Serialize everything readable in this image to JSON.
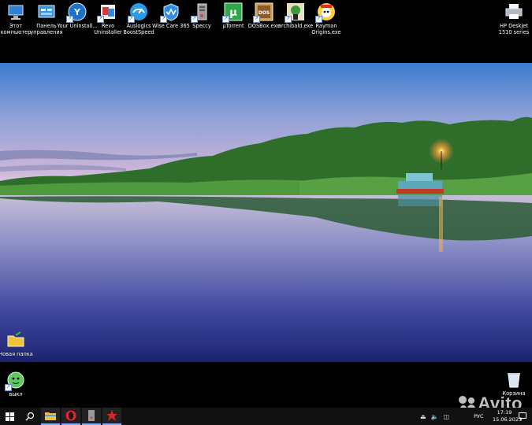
{
  "desktop": {
    "top_icons": [
      {
        "name": "this-pc-icon",
        "label": "Этот компьютер"
      },
      {
        "name": "control-panel-icon",
        "label": "Панель управления"
      },
      {
        "name": "your-uninstaller-icon",
        "label": "Your Uninstall..."
      },
      {
        "name": "revo-uninstaller-icon",
        "label": "Revo Uninstaller"
      },
      {
        "name": "auslogics-icon",
        "label": "Auslogics BoostSpeed"
      },
      {
        "name": "wise-care-icon",
        "label": "Wise Care 365"
      },
      {
        "name": "speccy-icon",
        "label": "Speccy"
      },
      {
        "name": "utorrent-icon",
        "label": "µTorrent"
      },
      {
        "name": "dosbox-icon",
        "label": "DOSBox.exe"
      },
      {
        "name": "archibald-icon",
        "label": "archibald.exe"
      },
      {
        "name": "rayman-icon",
        "label": "Rayman Origins.exe"
      }
    ],
    "printer_icon": {
      "label": "HP Deskjet 1510 series"
    },
    "folder_icon": {
      "label": "Новая папка"
    },
    "shutdown_icon": {
      "label": "выкл"
    },
    "recycle_bin": {
      "label": "Корзина"
    }
  },
  "taskbar": {
    "lang": "РУС",
    "time": "17:19",
    "date": "15.06.2023"
  },
  "watermark": {
    "text": "Avito"
  },
  "colors": {
    "taskbar": "#111111",
    "accent": "#7fb0ff"
  }
}
